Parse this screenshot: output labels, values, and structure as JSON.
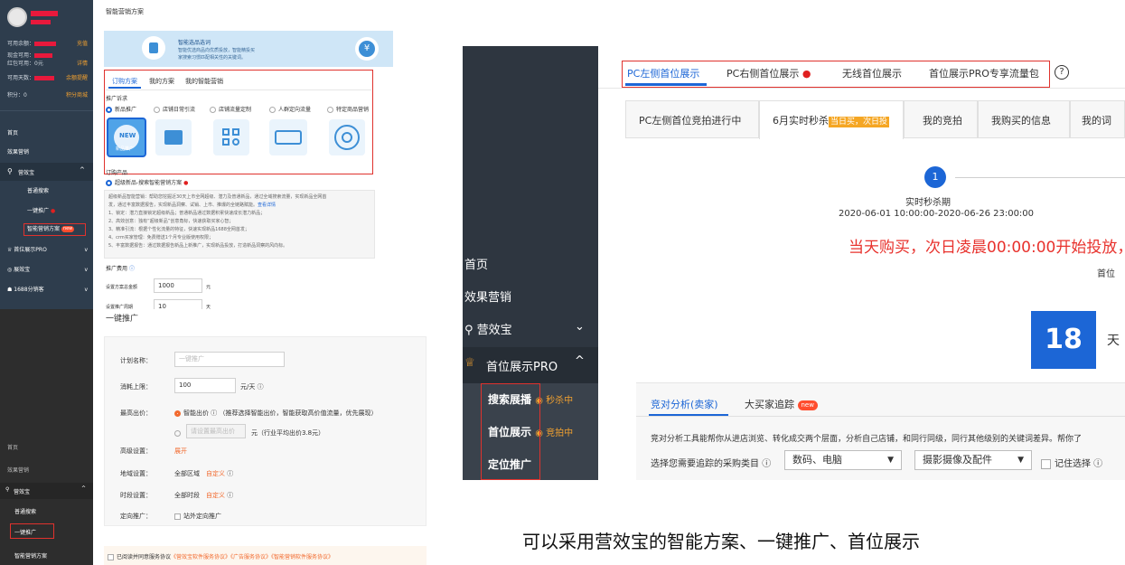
{
  "p1": {
    "sidebar": {
      "avail_balance": "可用余额：",
      "recharge": "充值",
      "cash_avail": "现金可用：",
      "redpack": "红包可用：0元",
      "detail": "详情",
      "days_avail": "可用天数：",
      "set_warning": "余额提醒",
      "points": "积分：0",
      "points_mall": "积分商城",
      "home": "首页",
      "effect_marketing": "效果营销",
      "yxb": "营效宝",
      "normal_search": "普通搜索",
      "one_key": "一键推广",
      "smart_plan": "智能营销方案",
      "new": "new",
      "top_display": "首位展示PRO",
      "industry": "展效宝",
      "distribution": "1688分销客"
    },
    "page_title": "智能营销方案",
    "banner_title": "智能选品选词",
    "banner_line1": "智能优选商品向优质投放，智能精投买",
    "banner_line2": "家搜索习惯匹配相关性的关键词。",
    "tabs": [
      "订购方案",
      "我的方案",
      "我的智能营销"
    ],
    "promo_demand": "推广诉求",
    "options": [
      "新品推广",
      "店铺日常引流",
      "店铺流量定制",
      "人群定向流量",
      "特定商品营销"
    ],
    "icon_new": "NEW",
    "icon_new_sub": "新品推广",
    "order_product": "订购产品",
    "product_name": "超级新品-搜索智能营销方案",
    "desc_lines": [
      "超级新品智能营销：帮助您挖掘近30天上市全网超级、潜力及普通新品，通过全域搜索流量，实现新品全网首",
      "发，通过丰富数据报告，实现新品洞察、试销、上市、推爆的全链路赋能。",
      "1、锁定：潜力直接锁定超级新品；普通新品通过数据积累快速成长潜力新品；",
      "2、高效创意：独有“超级新品”创意角标，快速获取买家心智；",
      "3、精准引流：根据个性化流量的特征，快速实现新品1688全网首发；",
      "4、crm买家管理：免费赠送1个月专业版使用权限；",
      "5、丰富数据报告：通过数据报告新品上新推广，实现新品投放，打造新品洞察的风向标。"
    ],
    "view_detail": "查看详情",
    "promo_fee": "推广费用",
    "total_label": "设置方案总金额",
    "total_value": "1000",
    "unit_yuan": "元",
    "period_label": "设置推广周期",
    "period_value": "10",
    "unit_day": "天"
  },
  "p2": {
    "sidebar": {
      "home": "首页",
      "effect_marketing": "效果营销",
      "yxb": "营效宝",
      "normal_search": "普通搜索",
      "one_key": "一键推广",
      "smart_plan": "智能营销方案"
    },
    "title": "一键推广",
    "plan_name_label": "计划名称：",
    "plan_name_placeholder": "一键推广",
    "consume_label": "消耗上限：",
    "consume_value": "100",
    "consume_unit": "元/天",
    "bid_label": "最高出价：",
    "bid_smart": "智能出价",
    "bid_smart_note": "（推荐选择智能出价，智能获取高价值流量，优先展现）",
    "bid_manual_placeholder": "请设置最高出价",
    "bid_manual_note": "元（行业平均出价3.8元）",
    "advanced_label": "高级设置：",
    "expand": "展开",
    "region_label": "地域设置：",
    "region_value": "全部区域",
    "custom": "自定义",
    "time_label": "时段设置：",
    "time_value": "全部时段",
    "target_label": "定向推广：",
    "target_value": "站外定向推广",
    "agree_prefix": "已阅读并同意服务协议",
    "agree_links": "《营效宝软件服务协议》《广告服务协议》《智能营销软件服务协议》"
  },
  "p3": {
    "sidebar": {
      "home": "首页",
      "effect_marketing": "效果营销",
      "yxb": "营效宝",
      "top_display": "首位展示PRO",
      "search_top": "搜索展播",
      "seckill": "秒杀中",
      "top_show": "首位展示",
      "bidding": "竞拍中",
      "location": "定位推广"
    },
    "top_tabs": [
      "PC左侧首位展示",
      "PC右侧首位展示",
      "无线首位展示",
      "首位展示PRO专享流量包"
    ],
    "sub_tabs": [
      "PC左侧首位竞拍进行中",
      "6月实时秒杀",
      "我的竞拍",
      "我购买的信息",
      "我的词"
    ],
    "sub_tab_badge": "当日买，次日投",
    "step_num": "1",
    "step_title": "实时秒杀期",
    "step_range": "2020-06-01 10:00:00-2020-06-26 23:00:00",
    "notice": "当天购买，次日凌晨00:00:00开始投放，直",
    "top_pos": "首位",
    "countdown": "18",
    "countdown_unit": "天",
    "analysis_tab": "竞对分析(卖家)",
    "tracking_tab": "大买家追踪",
    "new": "new",
    "analysis_desc": "竞对分析工具能帮你从进店浏览、转化成交两个层面，分析自己店铺，和同行同级，同行其他级别的关键词差异。帮你了",
    "choose_label": "选择您需要追踪的采购类目",
    "cat1": "数码、电脑",
    "cat2": "摄影摄像及配件",
    "remember": "记住选择"
  },
  "caption": "可以采用营效宝的智能方案、一键推广、首位展示"
}
